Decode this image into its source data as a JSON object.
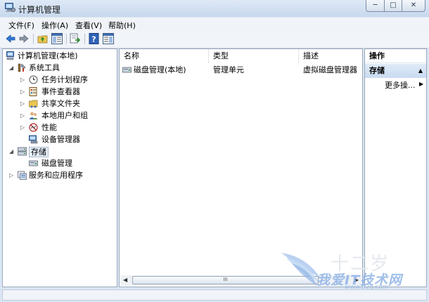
{
  "window": {
    "title": "计算机管理"
  },
  "title_buttons": {
    "minimize": "─",
    "maximize": "□",
    "close": "✕"
  },
  "menu": [
    "文件(F)",
    "操作(A)",
    "查看(V)",
    "帮助(H)"
  ],
  "toolbar": {
    "icons": [
      "back-icon",
      "forward-icon",
      "up-folder-icon",
      "show-hide-tree-icon",
      "export-list-icon",
      "help-icon",
      "show-hide-action-pane-icon"
    ]
  },
  "tree": {
    "root": "计算机管理(本地)",
    "items": [
      {
        "label": "系统工具",
        "icon": "tools-icon",
        "level": 1,
        "expander": "expanded"
      },
      {
        "label": "任务计划程序",
        "icon": "clock-icon",
        "level": 2,
        "expander": "collapsed"
      },
      {
        "label": "事件查看器",
        "icon": "event-viewer-icon",
        "level": 2,
        "expander": "collapsed"
      },
      {
        "label": "共享文件夹",
        "icon": "shared-folder-icon",
        "level": 2,
        "expander": "collapsed"
      },
      {
        "label": "本地用户和组",
        "icon": "users-icon",
        "level": 2,
        "expander": "collapsed"
      },
      {
        "label": "性能",
        "icon": "performance-icon",
        "level": 2,
        "expander": "collapsed"
      },
      {
        "label": "设备管理器",
        "icon": "device-manager-icon",
        "level": 2,
        "expander": "none"
      },
      {
        "label": "存储",
        "icon": "storage-icon",
        "level": 1,
        "expander": "expanded"
      },
      {
        "label": "磁盘管理",
        "icon": "disk-icon",
        "level": 2,
        "expander": "none"
      },
      {
        "label": "服务和应用程序",
        "icon": "services-icon",
        "level": 1,
        "expander": "collapsed"
      }
    ]
  },
  "list": {
    "columns": [
      "名称",
      "类型",
      "描述"
    ],
    "rows": [
      {
        "name": "磁盘管理(本地)",
        "type": "管理单元",
        "description": "虚拟磁盘管理器"
      }
    ],
    "scroll_thumb": "III"
  },
  "actions": {
    "header": "操作",
    "section": "存储",
    "links": [
      "更多操..."
    ]
  },
  "watermark": {
    "text": "我爱IT技术网",
    "url": "www.52ij.com",
    "ghost": "十二岁"
  },
  "colors": {
    "selection": "#cfe0f5",
    "frame": "#dbe6f4",
    "accent": "#1f5fbf"
  }
}
